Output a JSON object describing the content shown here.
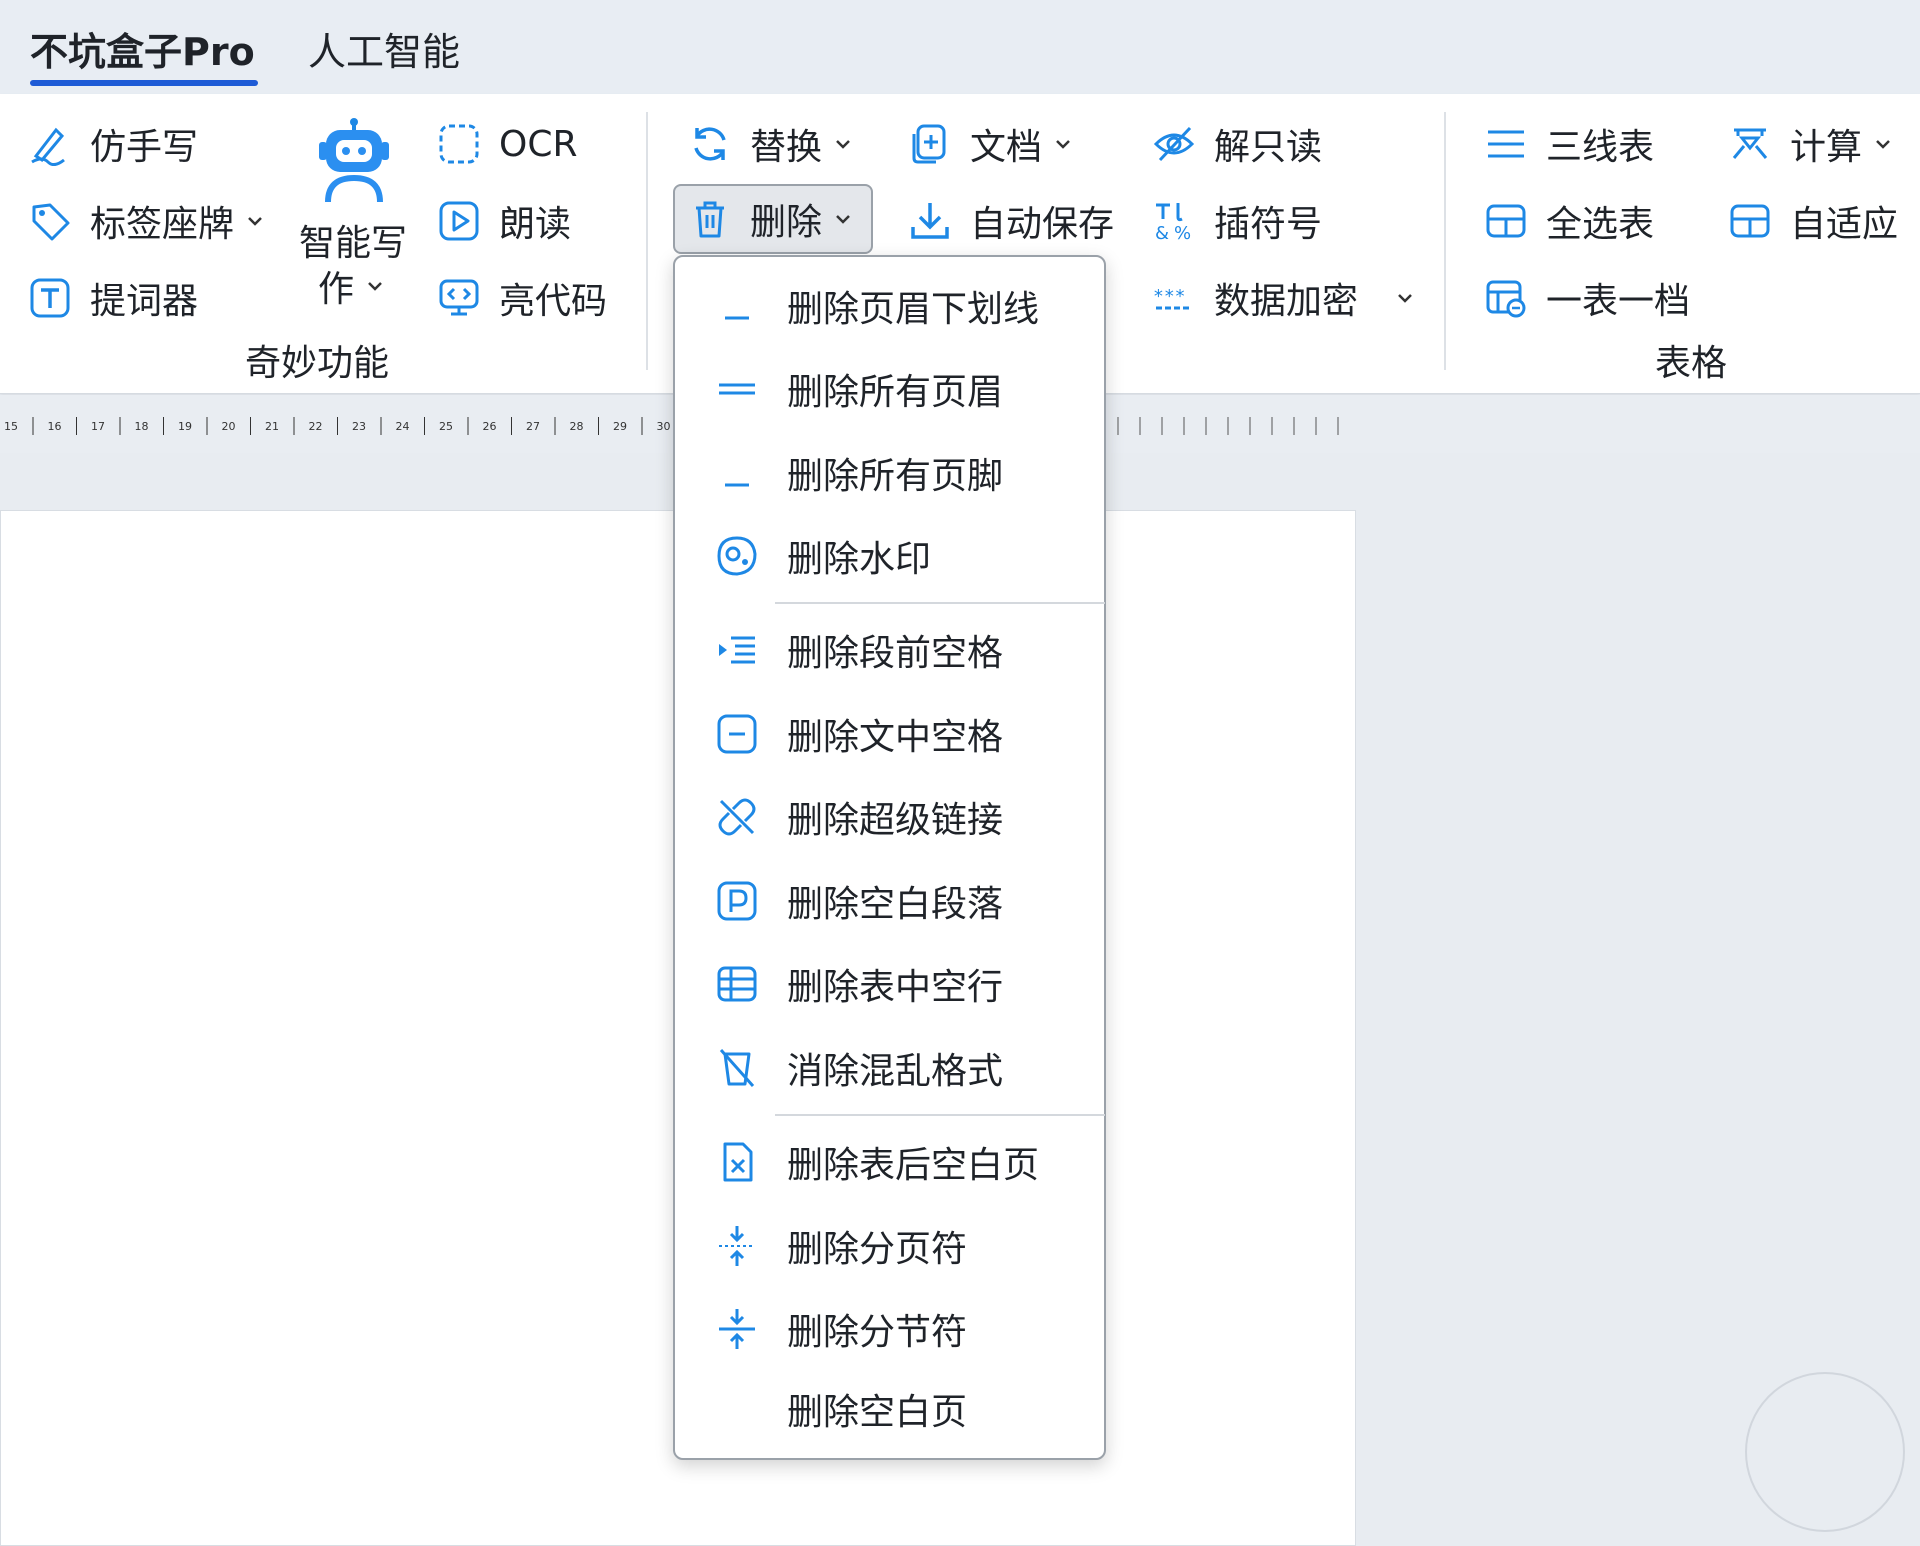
{
  "tabs": [
    {
      "label": "不坑盒子Pro",
      "active": true
    },
    {
      "label": "人工智能",
      "active": false
    }
  ],
  "groups": {
    "magic": {
      "label": "奇妙功能",
      "buttons": {
        "handwrite": "仿手写",
        "label_card": "标签座牌",
        "teleprompter": "提词器",
        "smart_write_line1": "智能写",
        "smart_write_line2": "作",
        "ocr": "OCR",
        "read_aloud": "朗读",
        "highlight_code": "亮代码"
      }
    },
    "edit": {
      "buttons": {
        "replace": "替换",
        "delete": "删除",
        "document": "文档",
        "autosave": "自动保存",
        "unlock_readonly": "解只读",
        "insert_symbol": "插符号",
        "data_encrypt": "数据加密"
      }
    },
    "table": {
      "label": "表格",
      "buttons": {
        "three_line": "三线表",
        "calculate": "计算",
        "select_all": "全选表",
        "autofit": "自适应",
        "one_table": "一表一档"
      }
    }
  },
  "ruler": {
    "numbers": [
      "15",
      "16",
      "17",
      "18",
      "19",
      "20",
      "21",
      "22",
      "23",
      "24",
      "25",
      "26",
      "27",
      "28",
      "29",
      "30"
    ]
  },
  "delete_menu": {
    "items": [
      {
        "label": "删除页眉下划线",
        "icon": "underline-icon"
      },
      {
        "label": "删除所有页眉",
        "icon": "double-line-icon"
      },
      {
        "label": "删除所有页脚",
        "icon": "underline-icon"
      },
      {
        "label": "删除水印",
        "icon": "watermark-icon"
      },
      {
        "label": "删除段前空格",
        "icon": "indent-icon"
      },
      {
        "label": "删除文中空格",
        "icon": "minus-box-icon"
      },
      {
        "label": "删除超级链接",
        "icon": "unlink-icon"
      },
      {
        "label": "删除空白段落",
        "icon": "paragraph-box-icon"
      },
      {
        "label": "删除表中空行",
        "icon": "table-rows-icon"
      },
      {
        "label": "消除混乱格式",
        "icon": "clear-format-icon"
      },
      {
        "label": "删除表后空白页",
        "icon": "file-x-icon"
      },
      {
        "label": "删除分页符",
        "icon": "page-break-icon"
      },
      {
        "label": "删除分节符",
        "icon": "section-break-icon"
      },
      {
        "label": "删除空白页",
        "icon": ""
      }
    ]
  },
  "colors": {
    "accent": "#1e88e5",
    "tab_underline": "#1e5bd6"
  }
}
